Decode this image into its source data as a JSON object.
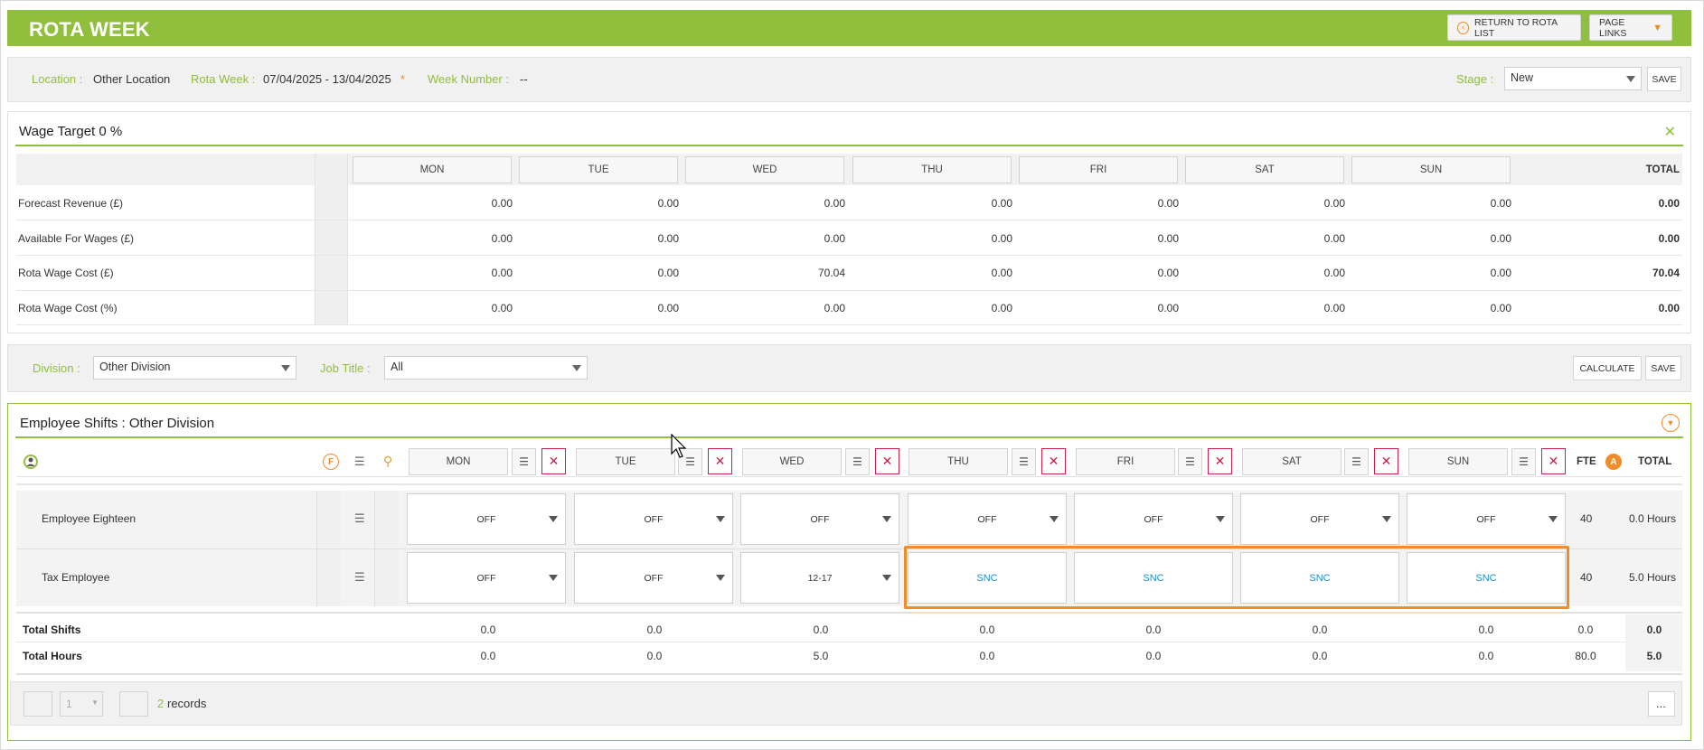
{
  "header": {
    "title": "ROTA WEEK",
    "return_label": "RETURN TO ROTA LIST",
    "page_links_label": "PAGE LINKS"
  },
  "location_bar": {
    "location_label": "Location :",
    "location_value": "Other Location",
    "rota_week_label": "Rota Week :",
    "rota_week_value": "07/04/2025 - 13/04/2025",
    "required_mark": "*",
    "week_number_label": "Week Number :",
    "week_number_value": "--",
    "stage_label": "Stage :",
    "stage_value": "New",
    "save_label": "SAVE"
  },
  "wage_target": {
    "title": "Wage Target 0 %",
    "close_glyph": "✕",
    "days": [
      "MON",
      "TUE",
      "WED",
      "THU",
      "FRI",
      "SAT",
      "SUN"
    ],
    "total_label": "TOTAL",
    "rows": [
      {
        "label": "Forecast Revenue (£)",
        "values": [
          "0.00",
          "0.00",
          "0.00",
          "0.00",
          "0.00",
          "0.00",
          "0.00"
        ],
        "total": "0.00"
      },
      {
        "label": "Available For Wages (£)",
        "values": [
          "0.00",
          "0.00",
          "0.00",
          "0.00",
          "0.00",
          "0.00",
          "0.00"
        ],
        "total": "0.00"
      },
      {
        "label": "Rota Wage Cost (£)",
        "values": [
          "0.00",
          "0.00",
          "70.04",
          "0.00",
          "0.00",
          "0.00",
          "0.00"
        ],
        "total": "70.04"
      },
      {
        "label": "Rota Wage Cost (%)",
        "values": [
          "0.00",
          "0.00",
          "0.00",
          "0.00",
          "0.00",
          "0.00",
          "0.00"
        ],
        "total": "0.00"
      }
    ]
  },
  "division_bar": {
    "division_label": "Division :",
    "division_value": "Other Division",
    "job_title_label": "Job Title :",
    "job_title_value": "All",
    "calculate_label": "CALCULATE",
    "save_label": "SAVE"
  },
  "shifts": {
    "title": "Employee Shifts : Other Division",
    "days": [
      "MON",
      "TUE",
      "WED",
      "THU",
      "FRI",
      "SAT",
      "SUN"
    ],
    "fte_label": "FTE",
    "total_label": "TOTAL",
    "f_badge": "F",
    "a_badge": "A",
    "employees": [
      {
        "name": "Employee Eighteen",
        "cells": [
          "OFF",
          "OFF",
          "OFF",
          "OFF",
          "OFF",
          "OFF",
          "OFF"
        ],
        "fte": "40",
        "total": "0.0 Hours"
      },
      {
        "name": "Tax Employee",
        "cells": [
          "OFF",
          "OFF",
          "12-17",
          "SNC",
          "SNC",
          "SNC",
          "SNC"
        ],
        "fte": "40",
        "total": "5.0 Hours"
      }
    ],
    "totals": [
      {
        "label": "Total Shifts",
        "values": [
          "0.0",
          "0.0",
          "0.0",
          "0.0",
          "0.0",
          "0.0",
          "0.0"
        ],
        "fte": "0.0",
        "total": "0.0"
      },
      {
        "label": "Total Hours",
        "values": [
          "0.0",
          "0.0",
          "5.0",
          "0.0",
          "0.0",
          "0.0",
          "0.0"
        ],
        "fte": "80.0",
        "total": "5.0"
      }
    ],
    "pager": {
      "page": "1",
      "record_count": "2",
      "records_label": "records",
      "more_label": "..."
    }
  },
  "colors": {
    "brand_green": "#8fbf3c",
    "accent_orange": "#f28c28",
    "delete_red": "#c9204b",
    "link_blue": "#1a8fd1"
  }
}
